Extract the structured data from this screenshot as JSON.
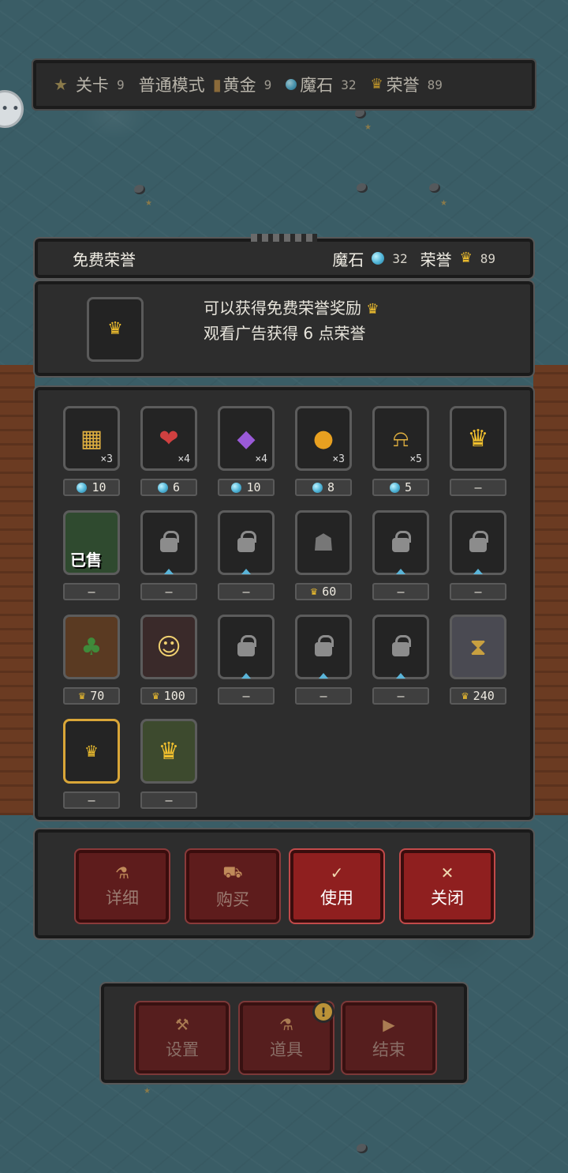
{
  "top_bar": {
    "level_label": "关卡",
    "level_value": "9",
    "mode_label": "普通模式",
    "gold_label": "黄金",
    "gold_value": "9",
    "stone_label": "魔石",
    "stone_value": "32",
    "honor_label": "荣誉",
    "honor_value": "89"
  },
  "header": {
    "title": "免费荣誉",
    "stone_label": "魔石",
    "stone_value": "32",
    "honor_label": "荣誉",
    "honor_value": "89"
  },
  "info": {
    "line1": "可以获得免费荣誉奖励",
    "line2": "观看广告获得 6 点荣誉"
  },
  "items": [
    {
      "icon": "gold-bars-icon",
      "glyph": "▦",
      "qty": "×3",
      "price": "10",
      "currency": "gem"
    },
    {
      "icon": "scroll-heart-icon",
      "glyph": "❤",
      "qty": "×4",
      "price": "6",
      "currency": "gem"
    },
    {
      "icon": "purple-crystal-icon",
      "glyph": "◆",
      "qty": "×4",
      "price": "10",
      "currency": "gem"
    },
    {
      "icon": "golden-apple-icon",
      "glyph": "●",
      "qty": "×3",
      "price": "8",
      "currency": "gem"
    },
    {
      "icon": "bell-icon",
      "glyph": "⍾",
      "qty": "×5",
      "price": "5",
      "currency": "gem"
    },
    {
      "icon": "crown-to-gem-icon",
      "glyph": "♛",
      "qty": "",
      "price": "—",
      "currency": ""
    },
    {
      "icon": "green-slime-icon",
      "glyph": "",
      "sold": "已售",
      "price": "—",
      "currency": ""
    },
    {
      "icon": "lock-icon",
      "locked": true,
      "price": "—",
      "currency": ""
    },
    {
      "icon": "lock-icon",
      "locked": true,
      "price": "—",
      "currency": ""
    },
    {
      "icon": "hooded-reaper-icon",
      "glyph": "☗",
      "price": "60",
      "currency": "crown"
    },
    {
      "icon": "lock-icon",
      "locked": true,
      "price": "—",
      "currency": ""
    },
    {
      "icon": "lock-icon",
      "locked": true,
      "price": "—",
      "currency": ""
    },
    {
      "icon": "tree-ent-icon",
      "glyph": "♣",
      "price": "70",
      "currency": "crown"
    },
    {
      "icon": "blonde-girl-icon",
      "glyph": "☺",
      "price": "100",
      "currency": "crown"
    },
    {
      "icon": "lock-icon",
      "locked": true,
      "price": "—",
      "currency": ""
    },
    {
      "icon": "lock-icon",
      "locked": true,
      "price": "—",
      "currency": ""
    },
    {
      "icon": "lock-icon",
      "locked": true,
      "price": "—",
      "currency": ""
    },
    {
      "icon": "hourglass-icon",
      "glyph": "⧗",
      "price": "240",
      "currency": "crown"
    },
    {
      "icon": "crown-icon",
      "glyph": "♛",
      "selected": true,
      "price": "—",
      "currency": ""
    },
    {
      "icon": "money-bag-icon",
      "glyph": "♛",
      "price": "—",
      "currency": ""
    }
  ],
  "actions": {
    "detail": "详细",
    "buy": "购买",
    "use": "使用",
    "close": "关闭"
  },
  "bottom": {
    "settings": "设置",
    "items": "道具",
    "end": "结束"
  }
}
